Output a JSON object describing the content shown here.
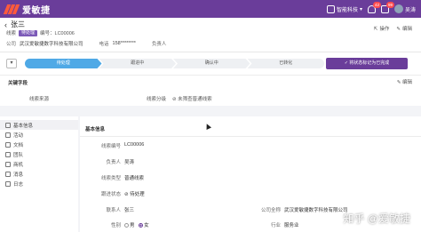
{
  "app": {
    "brand": "爱敏捷"
  },
  "nav": {
    "company": "智能科技",
    "notifications": "42",
    "messages": "99",
    "user": "吴涛"
  },
  "header": {
    "title": "张三",
    "sub_prefix": "线索",
    "status_tag": "待处理",
    "code_label": "编号：LC00006",
    "company_label": "公司",
    "company_value": "武汉爱敏捷数字科技有限公司",
    "phone_label": "电话",
    "phone_value": "158********",
    "owner_label": "负责人",
    "actions": {
      "action": "操作",
      "edit": "编辑"
    }
  },
  "stages": {
    "items": [
      "待处理",
      "跟进中",
      "确认中",
      "已转化"
    ],
    "button": "将状态标记为已完成"
  },
  "key_fields": {
    "title": "关键字段",
    "edit": "编辑",
    "source_label": "线索来源",
    "grade_label": "线索分级",
    "grade_value": "⊘ 未筛查普通线索"
  },
  "sidebar": {
    "items": [
      "基本信息",
      "活动",
      "文档",
      "团队",
      "商机",
      "消息",
      "日志"
    ]
  },
  "basic": {
    "title": "基本信息",
    "fields": {
      "code_label": "线索编号",
      "code_value": "LC00006",
      "owner_label": "负责人",
      "owner_value": "吴涛",
      "type_label": "线索类型",
      "type_value": "普通线索",
      "status_label": "跟进状态",
      "status_value": "⊘ 待处理",
      "contact_label": "联系人",
      "contact_value": "张三",
      "gender_label": "性别",
      "male": "男",
      "female": "女",
      "fullname_label": "公司全称",
      "fullname_value": "武汉爱敏捷数字科技有限公司",
      "industry_label": "行业",
      "industry_value": "服务业"
    }
  },
  "watermark": "知乎 @爱敏捷"
}
